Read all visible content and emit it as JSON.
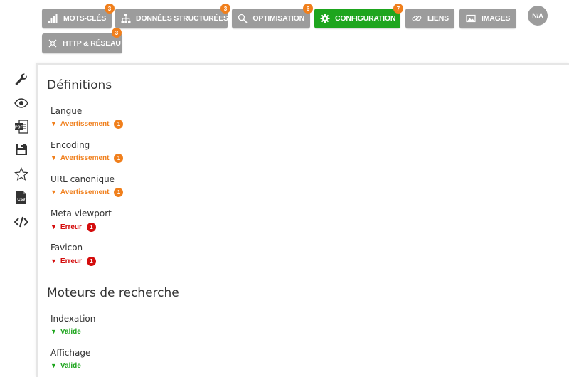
{
  "tabs": [
    {
      "label": "MOTS-CLÉS",
      "icon": "bar-chart-icon",
      "badge": "3",
      "active": false
    },
    {
      "label": "DONNÉES STRUCTURÉES",
      "icon": "sitemap-icon",
      "badge": "3",
      "active": false
    },
    {
      "label": "OPTIMISATION",
      "icon": "magnifier-icon",
      "badge": "6",
      "active": false
    },
    {
      "label": "CONFIGURATION",
      "icon": "gear-icon",
      "badge": "7",
      "active": true
    },
    {
      "label": "LIENS",
      "icon": "link-icon",
      "badge": "",
      "active": false
    },
    {
      "label": "IMAGES",
      "icon": "image-icon",
      "badge": "",
      "active": false
    },
    {
      "label": "HTTP & RÉSEAU",
      "icon": "network-icon",
      "badge": "3",
      "active": false
    }
  ],
  "na_label": "N/A",
  "sidebar": {
    "icons": [
      "wrench-icon",
      "eye-icon",
      "pdf-icon",
      "save-icon",
      "star-icon",
      "csv-icon",
      "code-icon"
    ],
    "pdf_text": "PDF",
    "csv_text": "CSV"
  },
  "sections": {
    "definitions": {
      "title": "Définitions",
      "items": [
        {
          "label": "Langue",
          "status": "Avertissement",
          "level": "warn",
          "count": "1"
        },
        {
          "label": "Encoding",
          "status": "Avertissement",
          "level": "warn",
          "count": "1"
        },
        {
          "label": "URL canonique",
          "status": "Avertissement",
          "level": "warn",
          "count": "1"
        },
        {
          "label": "Meta viewport",
          "status": "Erreur",
          "level": "err",
          "count": "1"
        },
        {
          "label": "Favicon",
          "status": "Erreur",
          "level": "err",
          "count": "1"
        }
      ]
    },
    "search_engines": {
      "title": "Moteurs de recherche",
      "items": [
        {
          "label": "Indexation",
          "status": "Valide",
          "level": "ok",
          "count": ""
        },
        {
          "label": "Affichage",
          "status": "Valide",
          "level": "ok",
          "count": ""
        }
      ]
    }
  },
  "colors": {
    "accent_active": "#1ea51e",
    "tab_gray": "#9c9c9c",
    "warning": "#f07f1c",
    "error": "#d40d0d",
    "valid": "#1ea51e"
  }
}
